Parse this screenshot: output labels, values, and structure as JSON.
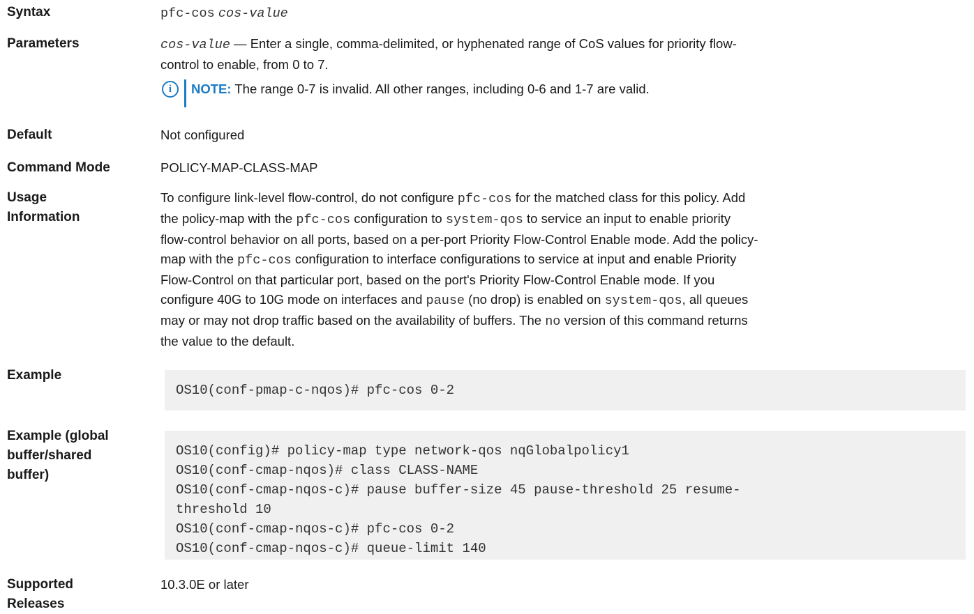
{
  "syntax": {
    "label": "Syntax",
    "command": "pfc-cos",
    "arg": "cos-value"
  },
  "parameters": {
    "label": "Parameters",
    "param": "cos-value",
    "desc_line1": " — Enter a single, comma-delimited, or hyphenated range of CoS values for priority flow-",
    "desc_line2": "control to enable, from 0 to 7.",
    "note_keyword": "NOTE:",
    "note_text": " The range 0-7 is invalid. All other ranges, including 0-6 and 1-7 are valid."
  },
  "default": {
    "label": "Default",
    "value": "Not configured"
  },
  "command_mode": {
    "label": "Command Mode",
    "value": "POLICY-MAP-CLASS-MAP"
  },
  "usage": {
    "label_line1": "Usage",
    "label_line2": "Information",
    "l1a": "To configure link-level flow-control, do not configure ",
    "l1b": "pfc-cos",
    "l1c": " for the matched class for this policy. Add",
    "l2a": "the policy-map with the ",
    "l2b": "pfc-cos",
    "l2c": " configuration to ",
    "l2d": "system-qos",
    "l2e": " to service an input to enable priority",
    "l3": "flow-control behavior on all ports, based on a per-port Priority Flow-Control Enable mode. Add the policy-",
    "l4a": "map with the ",
    "l4b": "pfc-cos",
    "l4c": " configuration to interface configurations to service at input and enable Priority",
    "l5": "Flow-Control on that particular port, based on the port's Priority Flow-Control Enable mode. If you",
    "l6a": "configure 40G to 10G mode on interfaces and ",
    "l6b": "pause",
    "l6c": " (no drop) is enabled on ",
    "l6d": "system-qos",
    "l6e": ", all queues",
    "l7a": "may or may not drop traffic based on the availability of buffers. The ",
    "l7b": "no",
    "l7c": " version of this command returns",
    "l8": "the value to the default."
  },
  "example": {
    "label": "Example",
    "code": "OS10(conf-pmap-c-nqos)# pfc-cos 0-2"
  },
  "example_global": {
    "label_line1": "Example (global",
    "label_line2": "buffer/shared",
    "label_line3": "buffer)",
    "code": "OS10(config)# policy-map type network-qos nqGlobalpolicy1\nOS10(conf-cmap-nqos)# class CLASS-NAME\nOS10(conf-cmap-nqos-c)# pause buffer-size 45 pause-threshold 25 resume-\nthreshold 10\nOS10(conf-cmap-nqos-c)# pfc-cos 0-2\nOS10(conf-cmap-nqos-c)# queue-limit 140"
  },
  "supported": {
    "label_line1": "Supported",
    "label_line2": "Releases",
    "value": "10.3.0E or later"
  },
  "colors": {
    "note_accent": "#1c7cc4",
    "code_bg": "#f0f0f0"
  },
  "icons": {
    "note": "info-icon"
  }
}
